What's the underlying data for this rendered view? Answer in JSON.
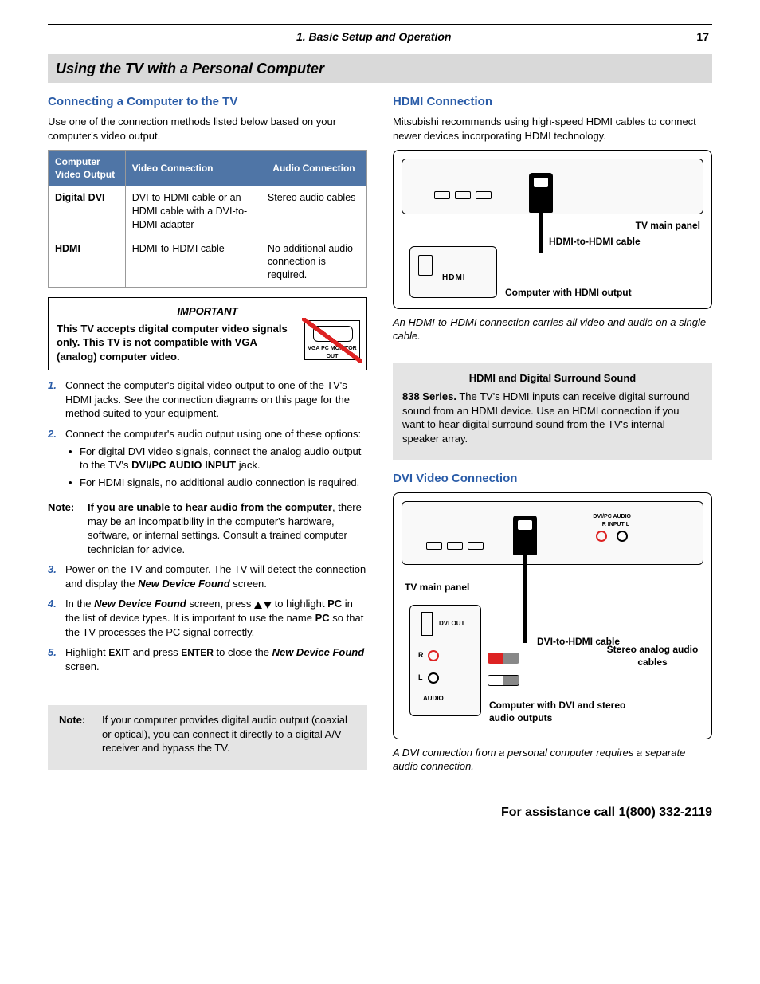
{
  "header": {
    "chapter": "1.  Basic Setup and Operation",
    "page": "17"
  },
  "sectionTitle": "Using the TV with a Personal Computer",
  "left": {
    "h1": "Connecting a Computer to the TV",
    "intro": "Use one of the connection methods listed below based on your computer's video output.",
    "table": {
      "headers": [
        "Computer Video Output",
        "Video Connection",
        "Audio Connection"
      ],
      "rows": [
        {
          "c0": "Digital DVI",
          "c1": "DVI-to-HDMI cable or an HDMI cable with a DVI-to-HDMI adapter",
          "c2": "Stereo audio cables"
        },
        {
          "c0": "HDMI",
          "c1": "HDMI-to-HDMI cable",
          "c2": "No additional audio connection is required."
        }
      ]
    },
    "important": {
      "title": "IMPORTANT",
      "body": "This TV accepts digital computer video signals only.  This TV is not compatible with VGA (analog) computer video.",
      "vgaLabel": "VGA PC MONITOR OUT"
    },
    "steps": {
      "s1": "Connect the computer's digital video output to one of the TV's HDMI jacks.  See the connection diagrams on this page for the method suited to your equipment.",
      "s2": "Connect the computer's audio output using one of these options:",
      "s2b1a": "For digital DVI video signals, connect the analog audio output to the TV's ",
      "s2b1b": "DVI/PC AUDIO INPUT",
      "s2b1c": " jack.",
      "s2b2": "For HDMI signals, no additional audio connection is required.",
      "noteLabel": "Note:",
      "noteBody1": "If you are unable to hear audio from the computer",
      "noteBody2": ", there may be an incompatibility in the computer's hardware, software, or internal settings.  Consult a trained computer technician for advice.",
      "s3a": "Power on the TV and computer.  The TV will detect the connection and display the ",
      "s3b": "New Device Found",
      "s3c": " screen.",
      "s4a": "In the ",
      "s4b": "New Device Found",
      "s4c": " screen, press ",
      "s4d": " to highlight ",
      "s4e": "PC",
      "s4f": " in the list of device types.  It is important to use the name ",
      "s4g": "PC",
      "s4h": " so that the TV processes the PC signal correctly.",
      "s5a": "Highlight ",
      "s5b": "EXIT",
      "s5c": " and press ",
      "s5d": "ENTER",
      "s5e": " to close the ",
      "s5f": "New Device Found",
      "s5g": " screen."
    },
    "bottomNote": {
      "label": "Note:",
      "body": "If your computer provides digital audio output (coaxial or optical), you can connect it directly to a digital A/V receiver and bypass the TV."
    }
  },
  "right": {
    "h1": "HDMI Connection",
    "intro": "Mitsubishi recommends using high-speed HDMI cables to connect newer devices incorporating HDMI technology.",
    "diagram1": {
      "tvPanel": "TV main panel",
      "cable": "HDMI-to-HDMI cable",
      "computer": "Computer with HDMI output",
      "hdmiLogo": "HDMI"
    },
    "caption1": "An HDMI-to-HDMI connection carries all video and audio on a single cable.",
    "grayBox": {
      "title": "HDMI and Digital Surround Sound",
      "lead": "838 Series.",
      "body": "  The TV's HDMI inputs can receive digital surround sound from an HDMI device.  Use an HDMI connection if you want to hear digital surround sound from the TV's internal speaker array."
    },
    "h2": "DVI Video Connection",
    "diagram2": {
      "tvPanel": "TV main panel",
      "dviCable": "DVI-to-HDMI cable",
      "audioCables": "Stereo analog audio cables",
      "computer": "Computer with DVI and stereo audio outputs",
      "dviOut": "DVI OUT",
      "r": "R",
      "l": "L",
      "audio": "AUDIO",
      "dvipc": "DVI/PC  AUDIO",
      "rinputl": "R   INPUT   L"
    },
    "caption2": "A DVI connection from a personal computer requires a separate audio connection."
  },
  "footer": "For assistance call 1(800) 332-2119"
}
